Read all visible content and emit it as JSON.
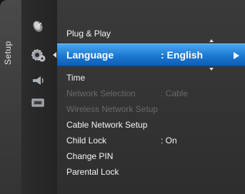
{
  "side_tab": {
    "label": "Setup"
  },
  "icons": [
    "satellite-dish-icon",
    "gear-icon",
    "sound-icon",
    "input-icon"
  ],
  "menu": {
    "items_before": [
      {
        "label": "Plug & Play",
        "value": "",
        "disabled": false
      }
    ],
    "selected": {
      "label": "Language",
      "value": ": English"
    },
    "items_after": [
      {
        "label": "Time",
        "value": "",
        "disabled": false
      },
      {
        "label": "Network Selection",
        "value": ": Cable",
        "disabled": true
      },
      {
        "label": "Wireless Network Setup",
        "value": "",
        "disabled": true
      },
      {
        "label": "Cable Network Setup",
        "value": "",
        "disabled": false
      },
      {
        "label": "Child Lock",
        "value": ": On",
        "disabled": false
      },
      {
        "label": "Change PIN",
        "value": "",
        "disabled": false
      },
      {
        "label": "Parental Lock",
        "value": "",
        "disabled": false
      }
    ]
  },
  "colors": {
    "highlight": "#1b78d2",
    "text": "#f5f5f5",
    "disabled_text": "#6a6a6a"
  }
}
